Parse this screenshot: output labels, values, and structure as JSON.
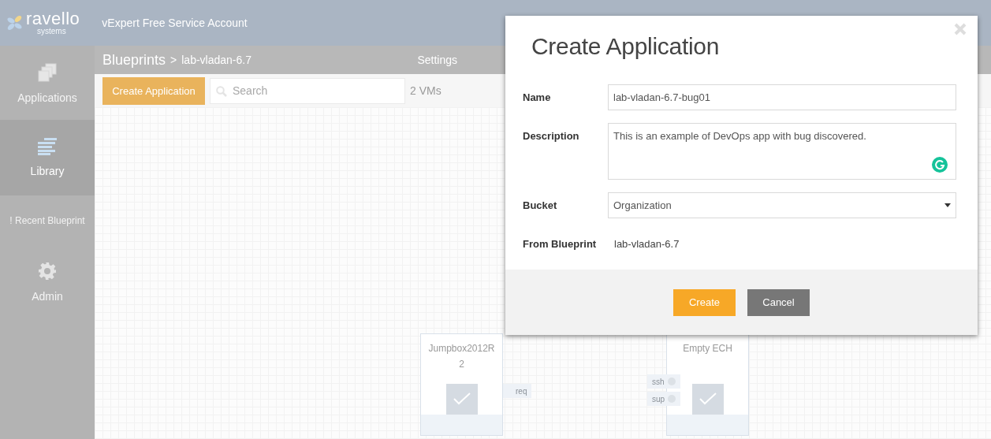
{
  "header": {
    "logo": "ravello",
    "logo_sub": "systems",
    "account": "vExpert Free Service Account"
  },
  "sidebar": {
    "items": [
      {
        "kind": "nav",
        "label": "Applications",
        "selected": false
      },
      {
        "kind": "nav",
        "label": "Library",
        "selected": true
      },
      {
        "kind": "notice",
        "label": "! Recent Blueprint"
      },
      {
        "kind": "nav",
        "label": "Admin",
        "selected": false
      }
    ]
  },
  "breadcrumb": {
    "root": "Blueprints",
    "separator": ">",
    "current": "lab-vladan-6.7"
  },
  "settings": "Settings",
  "toolbar": {
    "create_button": "Create Application",
    "search": {
      "placeholder": "Search"
    },
    "vm_count": "2 VMs"
  },
  "canvas": {
    "nodes": [
      {
        "title": "Jumpbox2012R2",
        "ports": [
          {
            "label": "req"
          }
        ]
      },
      {
        "title": "Empty ECH",
        "ports": [
          {
            "label": "ssh"
          },
          {
            "label": "sup"
          }
        ]
      }
    ]
  },
  "dialog": {
    "title": "Create Application",
    "fields": [
      {
        "kind": "text",
        "label": "Name",
        "value": "lab-vladan-6.7-bug01"
      },
      {
        "kind": "textarea",
        "label": "Description",
        "value": "This is an example of DevOps app with bug discovered."
      },
      {
        "kind": "select",
        "label": "Bucket",
        "value": "Organization"
      },
      {
        "kind": "static",
        "label": "From Blueprint",
        "value": "lab-vladan-6.7"
      }
    ],
    "buttons": [
      {
        "kind": "primary",
        "label": "Create"
      },
      {
        "kind": "secondary",
        "label": "Cancel"
      }
    ]
  }
}
